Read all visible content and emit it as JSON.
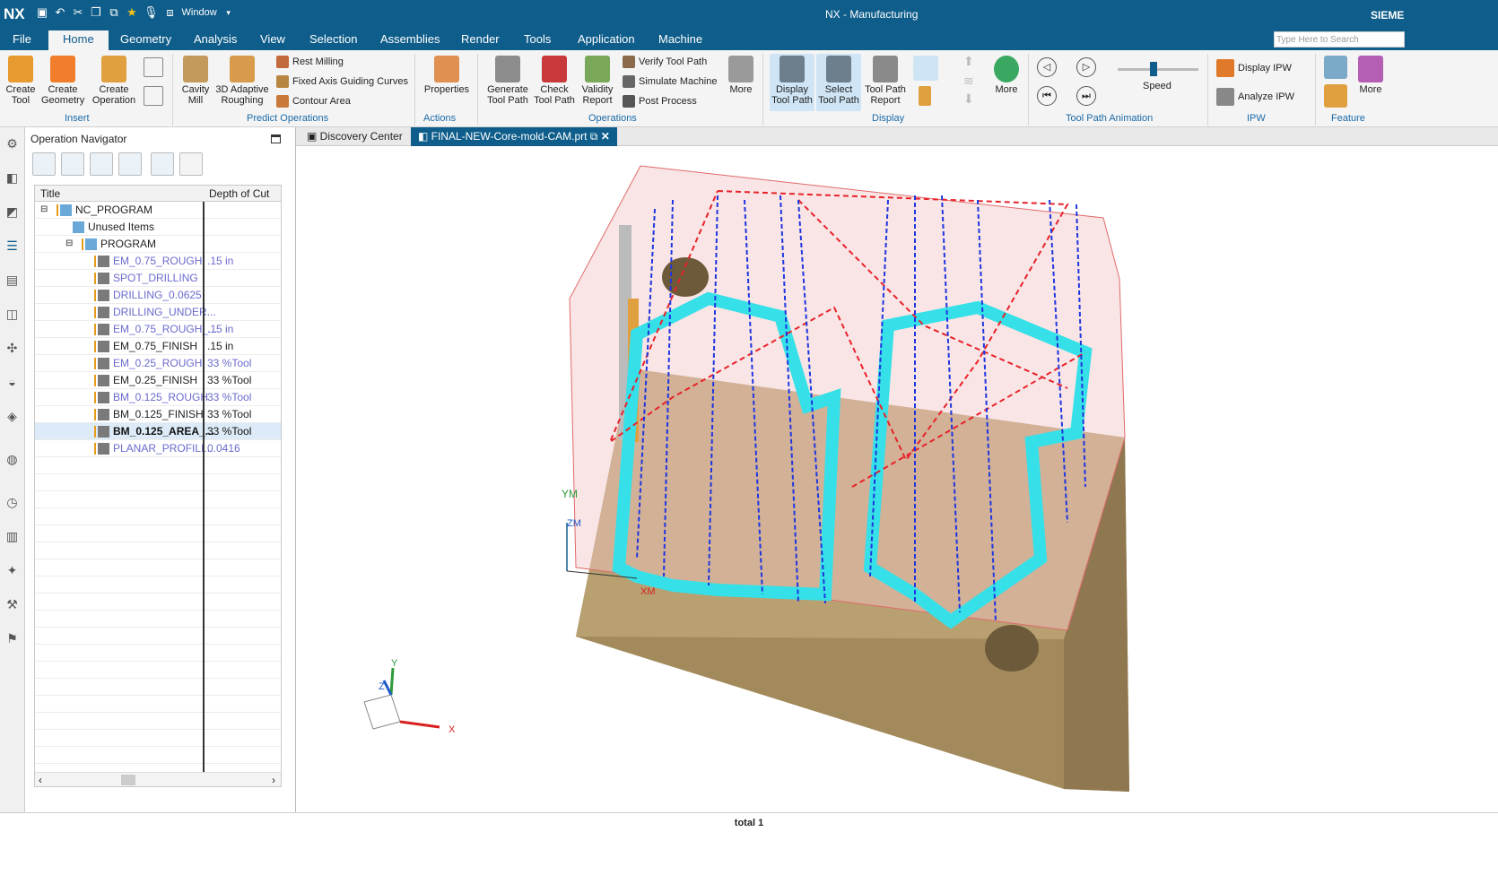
{
  "app": {
    "logo": "NX",
    "title": "NX - Manufacturing",
    "brand": "SIEME",
    "window_menu": "Window"
  },
  "menu": {
    "items": [
      "File",
      "Home",
      "Geometry",
      "Analysis",
      "View",
      "Selection",
      "Assemblies",
      "Render",
      "Tools",
      "Application",
      "Machine"
    ],
    "active": "Home",
    "search_placeholder": "Type Here to Search"
  },
  "ribbon": {
    "create_tool": "Create Tool",
    "create_geometry": "Create Geometry",
    "create_operation": "Create Operation",
    "insert_group": "Insert",
    "cavity_mill": "Cavity Mill",
    "adaptive": "3D Adaptive Roughing",
    "rest_milling": "Rest Milling",
    "fixed_axis": "Fixed Axis Guiding Curves",
    "contour_area": "Contour Area",
    "predict_group": "Predict Operations",
    "properties": "Properties",
    "actions_group": "Actions",
    "generate": "Generate Tool Path",
    "check": "Check Tool Path",
    "validity": "Validity Report",
    "verify": "Verify Tool Path",
    "simulate": "Simulate Machine",
    "post": "Post Process",
    "operations_group": "Operations",
    "more1": "More",
    "display_tp": "Display Tool Path",
    "select_tp": "Select Tool Path",
    "tp_report": "Tool Path Report",
    "display_group": "Display",
    "more2": "More",
    "speed": "Speed",
    "anim_group": "Tool Path Animation",
    "display_ipw": "Display IPW",
    "analyze_ipw": "Analyze IPW",
    "ipw_group": "IPW",
    "more3": "More",
    "feature_group": "Feature"
  },
  "navigator": {
    "title": "Operation Navigator",
    "col_title": "Title",
    "col_depth": "Depth of Cut",
    "rows": [
      {
        "name": "NC_PROGRAM",
        "depth": "",
        "color": "#222"
      },
      {
        "name": "Unused Items",
        "depth": "",
        "color": "#222"
      },
      {
        "name": "PROGRAM",
        "depth": "",
        "color": "#222"
      },
      {
        "name": "EM_0.75_ROUGH",
        "depth": ".15 in",
        "color": "#6a6acf"
      },
      {
        "name": "SPOT_DRILLING",
        "depth": "",
        "color": "#6a6acf"
      },
      {
        "name": "DRILLING_0.0625",
        "depth": "",
        "color": "#6a6acf"
      },
      {
        "name": "DRILLING_UNDER...",
        "depth": "",
        "color": "#6a6acf"
      },
      {
        "name": "EM_0.75_ROUGH_...",
        "depth": ".15 in",
        "color": "#6a6acf"
      },
      {
        "name": "EM_0.75_FINISH",
        "depth": ".15 in",
        "color": "#222"
      },
      {
        "name": "EM_0.25_ROUGH",
        "depth": "33 %Tool",
        "color": "#6a6acf"
      },
      {
        "name": "EM_0.25_FINISH",
        "depth": "33 %Tool",
        "color": "#222"
      },
      {
        "name": "BM_0.125_ROUGH",
        "depth": "33 %Tool",
        "color": "#6a6acf"
      },
      {
        "name": "BM_0.125_FINISH",
        "depth": "33 %Tool",
        "color": "#222"
      },
      {
        "name": "BM_0.125_AREA_...",
        "depth": "33 %Tool",
        "color": "#111"
      },
      {
        "name": "PLANAR_PROFILI...",
        "depth": "0.0416",
        "color": "#6a6acf"
      }
    ]
  },
  "tabs": {
    "discovery": "Discovery Center",
    "file": "FINAL-NEW-Core-mold-CAM.prt"
  },
  "viewport": {
    "ym": "YM",
    "zm": "ZM",
    "xm": "XM",
    "tri_x": "X",
    "tri_y": "Y",
    "tri_z": "Z"
  },
  "status": "total 1",
  "colors": {
    "brand": "#0e5d8a",
    "part": "#b8a071",
    "toolpath_cut": "#1e35e0",
    "toolpath_rapid": "#e8222a",
    "ipw": "#36e0e8"
  }
}
